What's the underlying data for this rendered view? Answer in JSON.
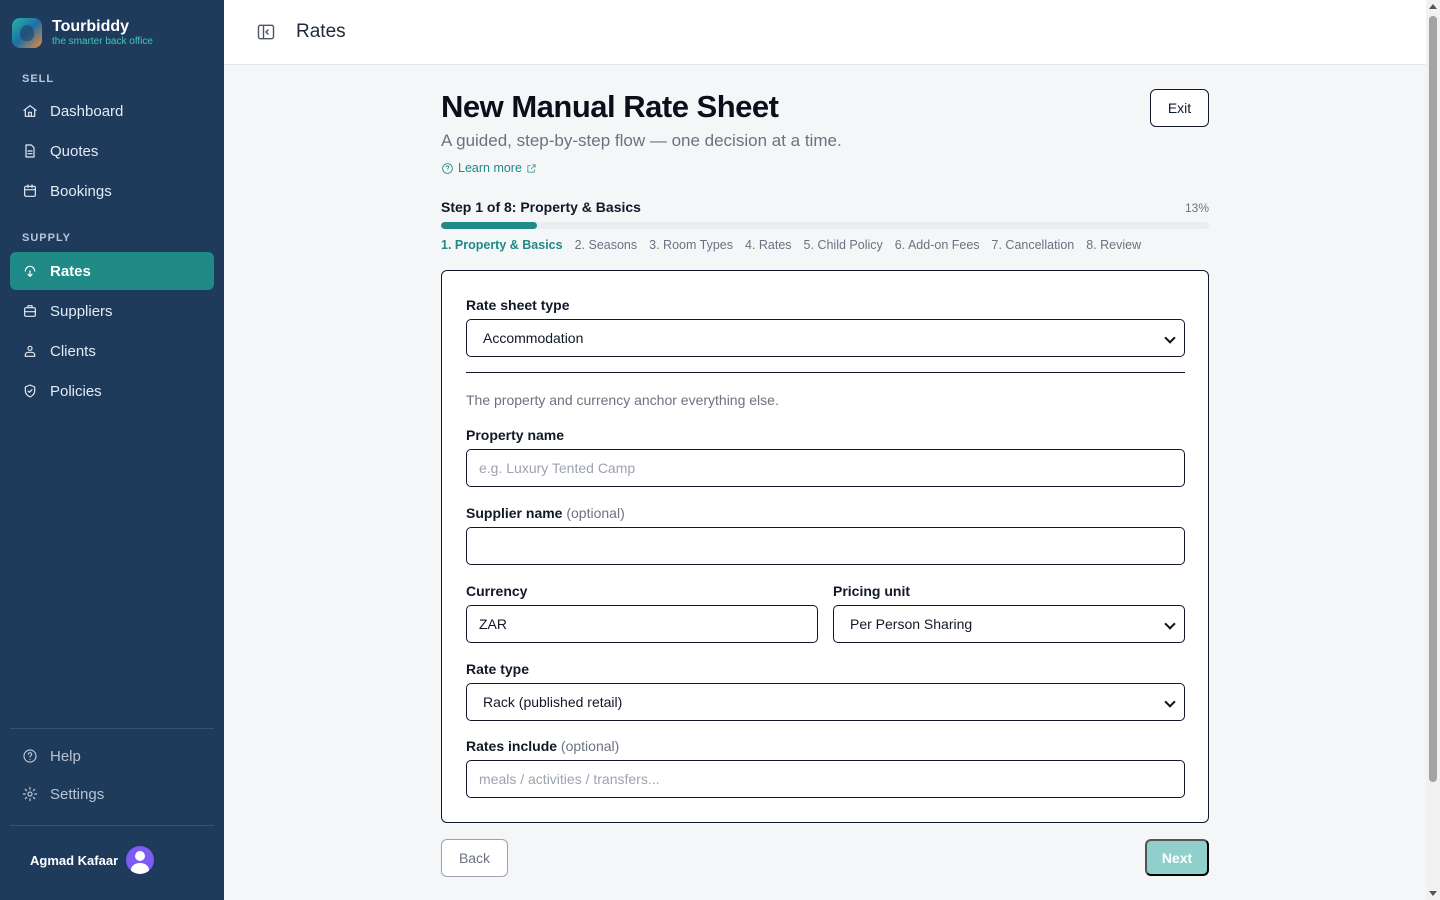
{
  "brand": {
    "name": "Tourbiddy",
    "tagline": "the smarter back office"
  },
  "sidebar": {
    "sell_label": "SELL",
    "supply_label": "SUPPLY",
    "items": [
      {
        "label": "Dashboard",
        "icon": "home-icon"
      },
      {
        "label": "Quotes",
        "icon": "document-icon"
      },
      {
        "label": "Bookings",
        "icon": "calendar-icon"
      },
      {
        "label": "Rates",
        "icon": "tag-icon",
        "active": true
      },
      {
        "label": "Suppliers",
        "icon": "briefcase-icon"
      },
      {
        "label": "Clients",
        "icon": "users-icon"
      },
      {
        "label": "Policies",
        "icon": "shield-icon"
      }
    ],
    "footer": [
      {
        "label": "Help",
        "icon": "help-circle-icon"
      },
      {
        "label": "Settings",
        "icon": "gear-icon"
      }
    ],
    "user": {
      "name": "Agmad Kafaar"
    }
  },
  "header": {
    "title": "Rates"
  },
  "page": {
    "title": "New Manual Rate Sheet",
    "subtitle": "A guided, step-by-step flow — one decision at a time.",
    "learn_more": "Learn more",
    "exit_label": "Exit"
  },
  "progress": {
    "step_title": "Step 1 of 8: Property & Basics",
    "percent_label": "13%",
    "fraction": 0.125,
    "steps": [
      "1. Property & Basics",
      "2. Seasons",
      "3. Room Types",
      "4. Rates",
      "5. Child Policy",
      "6. Add-on Fees",
      "7. Cancellation",
      "8. Review"
    ]
  },
  "form": {
    "rate_sheet_type": {
      "label": "Rate sheet type",
      "value": "Accommodation"
    },
    "hint": "The property and currency anchor everything else.",
    "property_name": {
      "label": "Property name",
      "placeholder": "e.g. Luxury Tented Camp"
    },
    "supplier_name": {
      "label": "Supplier name",
      "optional": "(optional)",
      "value": ""
    },
    "currency": {
      "label": "Currency",
      "value": "ZAR"
    },
    "pricing_unit": {
      "label": "Pricing unit",
      "value": "Per Person Sharing"
    },
    "rate_type": {
      "label": "Rate type",
      "value": "Rack (published retail)"
    },
    "rates_include": {
      "label": "Rates include",
      "optional": "(optional)",
      "placeholder": "meals / activities / transfers..."
    }
  },
  "actions": {
    "back_label": "Back",
    "next_label": "Next"
  },
  "colors": {
    "sidebar_bg": "#1f3b5c",
    "accent": "#1f8a86",
    "next_disabled": "#8fcfcc"
  }
}
